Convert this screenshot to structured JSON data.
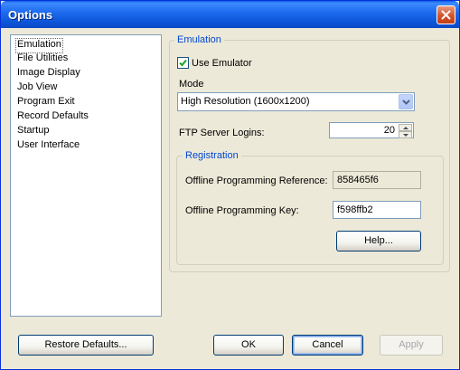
{
  "window": {
    "title": "Options"
  },
  "sidebar": {
    "items": [
      {
        "label": "Emulation",
        "selected": true
      },
      {
        "label": "File Utilities"
      },
      {
        "label": "Image Display"
      },
      {
        "label": "Job View"
      },
      {
        "label": "Program Exit"
      },
      {
        "label": "Record Defaults"
      },
      {
        "label": "Startup"
      },
      {
        "label": "User Interface"
      }
    ]
  },
  "emulation": {
    "group_label": "Emulation",
    "use_emulator_label": "Use Emulator",
    "use_emulator_checked": true,
    "mode_label": "Mode",
    "mode_value": "High Resolution (1600x1200)",
    "ftp_label": "FTP Server Logins:",
    "ftp_value": "20"
  },
  "registration": {
    "group_label": "Registration",
    "reference_label": "Offline Programming Reference:",
    "reference_value": "858465f6",
    "key_label": "Offline Programming Key:",
    "key_value": "f598ffb2",
    "help_label": "Help..."
  },
  "footer": {
    "restore_label": "Restore Defaults...",
    "ok_label": "OK",
    "cancel_label": "Cancel",
    "apply_label": "Apply"
  },
  "icons": {
    "close": "close-icon",
    "checkbox": "checkmark-icon",
    "dropdown": "chevron-down-icon",
    "spin_up": "arrow-up-icon",
    "spin_down": "arrow-down-icon"
  },
  "colors": {
    "titlebar": "#0a5fe8",
    "group_label": "#0046d5",
    "window_bg": "#ece9d8",
    "close_button": "#d4532a"
  }
}
